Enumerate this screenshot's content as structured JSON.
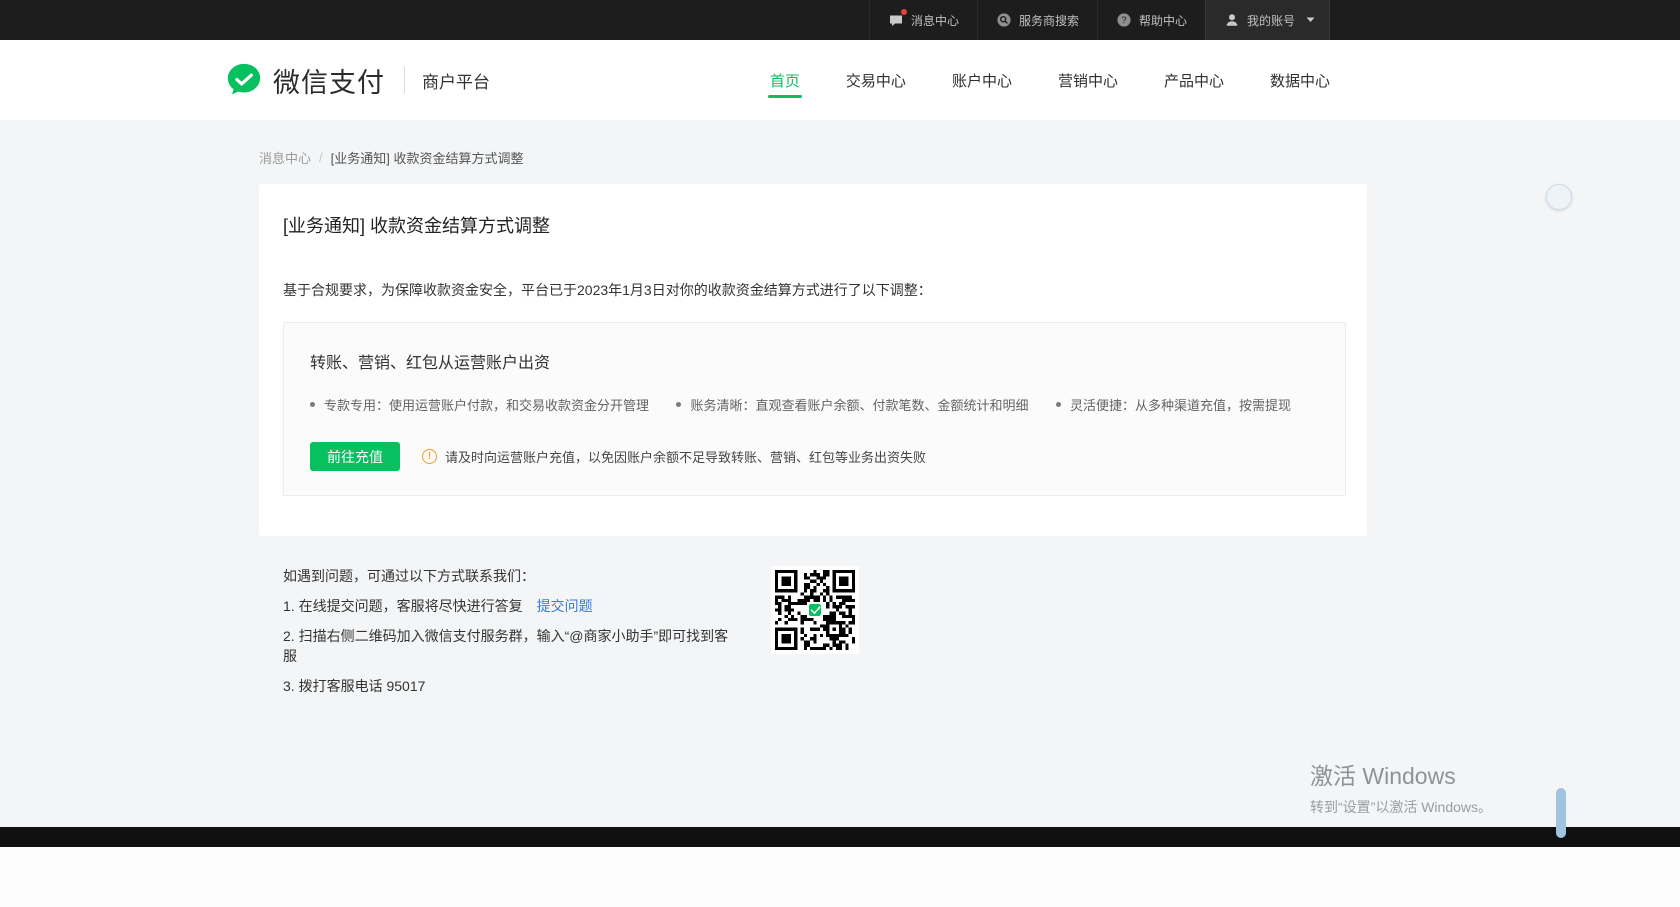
{
  "topbar": {
    "items": [
      {
        "label": "消息中心",
        "icon": "message-icon",
        "badge": "unread-dot"
      },
      {
        "label": "服务商搜索",
        "icon": "search-icon"
      },
      {
        "label": "帮助中心",
        "icon": "help-icon"
      },
      {
        "label": "我的账号",
        "icon": "account-icon",
        "chevron": "chevron-down-icon"
      }
    ]
  },
  "header": {
    "brand": "微信支付",
    "platform": "商户平台",
    "nav": [
      {
        "label": "首页",
        "active": true
      },
      {
        "label": "交易中心",
        "active": false
      },
      {
        "label": "账户中心",
        "active": false
      },
      {
        "label": "营销中心",
        "active": false
      },
      {
        "label": "产品中心",
        "active": false
      },
      {
        "label": "数据中心",
        "active": false
      }
    ]
  },
  "breadcrumb": {
    "parent": "消息中心",
    "separator": "/",
    "current": "[业务通知] 收款资金结算方式调整"
  },
  "notice": {
    "title": "[业务通知] 收款资金结算方式调整",
    "intro": "基于合规要求，为保障收款资金安全，平台已于2023年1月3日对你的收款资金结算方式进行了以下调整：",
    "panel": {
      "title": "转账、营销、红包从运营账户出资",
      "bullets": [
        "专款专用：使用运营账户付款，和交易收款资金分开管理",
        "账务清晰：直观查看账户余额、付款笔数、金额统计和明细",
        "灵活便捷：从多种渠道充值，按需提现"
      ],
      "button": "前往充值",
      "warning": "请及时向运营账户充值，以免因账户余额不足导致转账、营销、红包等业务出资失败"
    }
  },
  "contact": {
    "heading": "如遇到问题，可通过以下方式联系我们：",
    "line1": "1. 在线提交问题，客服将尽快进行答复",
    "link1": "提交问题",
    "line2": "2. 扫描右侧二维码加入微信支付服务群，输入“@商家小助手”即可找到客服",
    "line3": "3. 拨打客服电话 95017",
    "qr": "wechat-pay-service-group-qr"
  },
  "watermark": {
    "line1": "激活 Windows",
    "line2": "转到“设置”以激活 Windows。"
  },
  "colors": {
    "brand_green": "#07C160",
    "link_blue": "#3A7BD5",
    "warning_orange": "#F59A23",
    "badge_red": "#E64340"
  }
}
